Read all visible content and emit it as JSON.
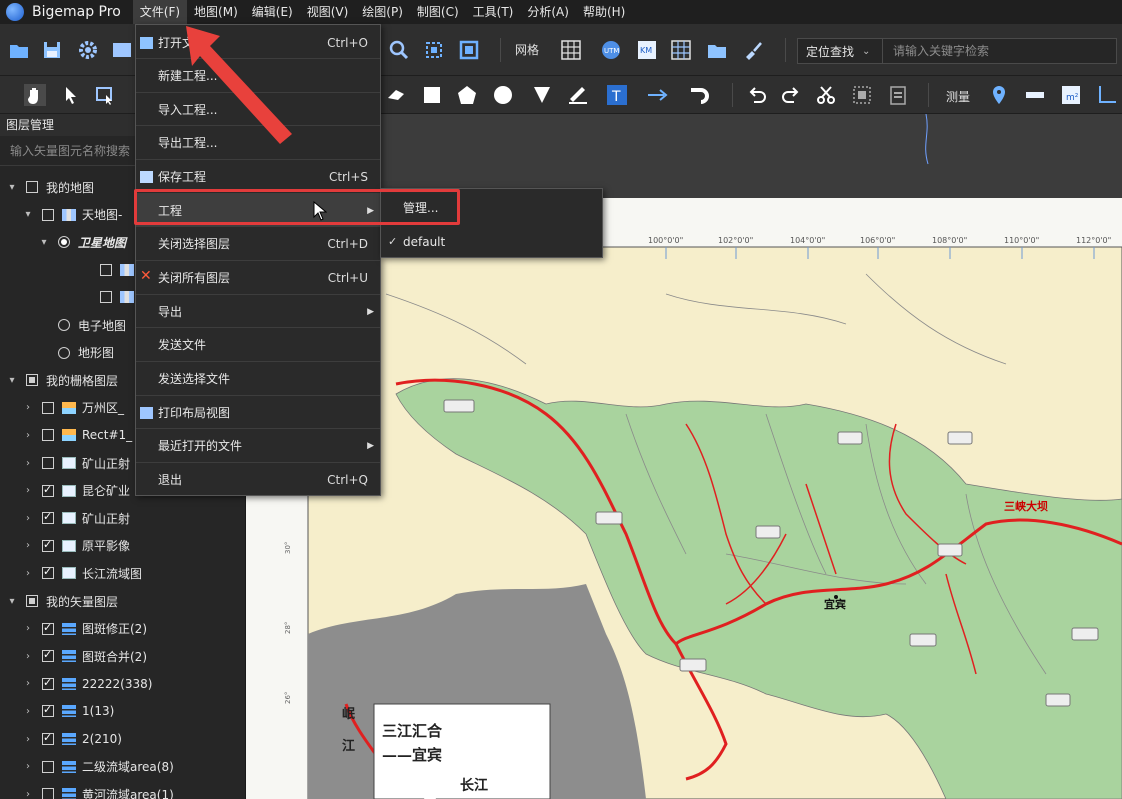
{
  "app": {
    "title": "Bigemap Pro"
  },
  "menubar": [
    {
      "label": "文件(F)",
      "active": true
    },
    {
      "label": "地图(M)"
    },
    {
      "label": "编辑(E)"
    },
    {
      "label": "视图(V)"
    },
    {
      "label": "绘图(P)"
    },
    {
      "label": "制图(C)"
    },
    {
      "label": "工具(T)"
    },
    {
      "label": "分析(A)"
    },
    {
      "label": "帮助(H)"
    }
  ],
  "toolbar": {
    "grid_label": "网格",
    "locate_label": "定位查找",
    "search_placeholder": "请输入关键字检索",
    "measure_label": "测量",
    "grid_icon_text": "田"
  },
  "layer_panel": {
    "title": "图层管理",
    "search_placeholder": "输入矢量图元名称搜索",
    "rows": [
      {
        "label": "我的地图"
      },
      {
        "label": "天地图-"
      },
      {
        "label": "卫星地图"
      },
      {
        "label": "天"
      },
      {
        "label": "天"
      },
      {
        "label": "电子地图"
      },
      {
        "label": "地形图"
      },
      {
        "label": "我的栅格图层"
      },
      {
        "label": "万州区_"
      },
      {
        "label": "Rect#1_"
      },
      {
        "label": "矿山正射"
      },
      {
        "label": "昆仑矿业"
      },
      {
        "label": "矿山正射"
      },
      {
        "label": "原平影像"
      },
      {
        "label": "长江流域图"
      },
      {
        "label": "我的矢量图层"
      },
      {
        "label": "图斑修正(2)"
      },
      {
        "label": "图斑合并(2)"
      },
      {
        "label": "22222(338)"
      },
      {
        "label": "1(13)"
      },
      {
        "label": "2(210)"
      },
      {
        "label": "二级流域area(8)"
      },
      {
        "label": "黄河流域area(1)"
      }
    ]
  },
  "file_menu": [
    {
      "label": "打开文",
      "shortcut": "Ctrl+O"
    },
    {
      "label": "新建工程..."
    },
    {
      "label": "导入工程..."
    },
    {
      "label": "导出工程..."
    },
    {
      "label": "保存工程",
      "shortcut": "Ctrl+S"
    },
    {
      "label": "工程"
    },
    {
      "label": "关闭选择图层",
      "shortcut": "Ctrl+D"
    },
    {
      "label": "关闭所有图层",
      "shortcut": "Ctrl+U"
    },
    {
      "label": "导出"
    },
    {
      "label": "发送文件"
    },
    {
      "label": "发送选择文件"
    },
    {
      "label": "打印布局视图"
    },
    {
      "label": "最近打开的文件"
    },
    {
      "label": "退出",
      "shortcut": "Ctrl+Q"
    }
  ],
  "project_submenu": [
    {
      "label": "管理..."
    },
    {
      "label": "default"
    }
  ],
  "map": {
    "lon_ticks": [
      "100°0'0\"",
      "102°0'0\"",
      "104°0'0\"",
      "106°0'0\"",
      "108°0'0\"",
      "110°0'0\"",
      "112°0'0\""
    ],
    "callout_line1": "三江汇合",
    "callout_line2": "——宜宾",
    "left_vertical_text_1": "岷",
    "left_vertical_text_2": "江",
    "river_label": "长江",
    "place_labels": [
      "宜宾",
      "三峡大坝"
    ]
  },
  "colors": {
    "basin_green": "#a9d39e",
    "land_beige": "#f6eecb",
    "river_red": "#e02020",
    "gray_area": "#8a8a8a",
    "highlight_red": "#e23b3b"
  }
}
